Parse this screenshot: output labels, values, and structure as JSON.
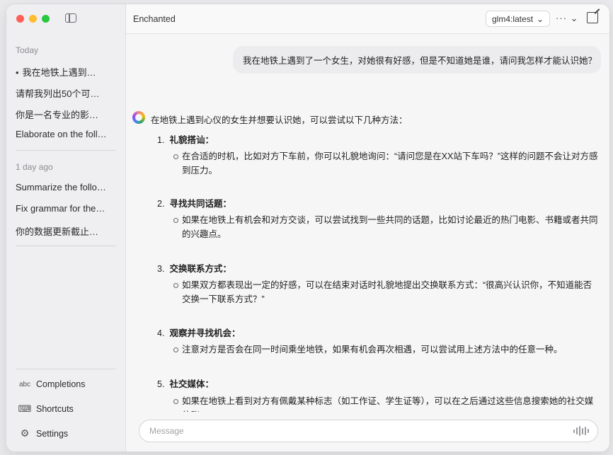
{
  "window": {
    "traffic_colors": [
      "#fe5f57",
      "#febc2e",
      "#28c840"
    ]
  },
  "sidebar": {
    "sections": [
      {
        "label": "Today",
        "items": [
          {
            "label": "我在地铁上遇到…",
            "active": true
          },
          {
            "label": "请帮我列出50个可…",
            "active": false
          },
          {
            "label": "你是一名专业的影…",
            "active": false
          },
          {
            "label": "Elaborate on the foll…",
            "active": false
          }
        ]
      },
      {
        "label": "1 day ago",
        "items": [
          {
            "label": "Summarize the follo…",
            "active": false
          },
          {
            "label": "Fix grammar for the…",
            "active": false
          },
          {
            "label": "你的数据更新截止…",
            "active": false
          }
        ]
      }
    ],
    "bottom": [
      {
        "icon": "abc-icon",
        "icon_text": "abc",
        "label": "Completions"
      },
      {
        "icon": "keyboard-icon",
        "icon_text": "⌨",
        "label": "Shortcuts"
      },
      {
        "icon": "gear-icon",
        "icon_text": "⚙",
        "label": "Settings"
      }
    ]
  },
  "topbar": {
    "title": "Enchanted",
    "model": "glm4:latest",
    "model_caret": "⌄",
    "more": "··· ⌄"
  },
  "conversation": {
    "user_message": "我在地铁上遇到了一个女生，对她很有好感，但是不知道她是谁，请问我怎样才能认识她？",
    "assistant_intro": "在地铁上遇到心仪的女生并想要认识她，可以尝试以下几种方法：",
    "items": [
      {
        "num": "1.",
        "title": "礼貌搭讪：",
        "body": "在合适的时机，比如对方下车前，你可以礼貌地询问：“请问您是在XX站下车吗？”这样的问题不会让对方感到压力。"
      },
      {
        "num": "2.",
        "title": "寻找共同话题：",
        "body": "如果在地铁上有机会和对方交谈，可以尝试找到一些共同的话题，比如讨论最近的热门电影、书籍或者共同的兴趣点。"
      },
      {
        "num": "3.",
        "title": "交换联系方式：",
        "body": "如果双方都表现出一定的好感，可以在结束对话时礼貌地提出交换联系方式：“很高兴认识你，不知道能否交换一下联系方式？”"
      },
      {
        "num": "4.",
        "title": "观察并寻找机会：",
        "body": "注意对方是否会在同一时间乘坐地铁，如果有机会再次相遇，可以尝试用上述方法中的任意一种。"
      },
      {
        "num": "5.",
        "title": "社交媒体：",
        "body": "如果在地铁上看到对方有佩戴某种标志（如工作证、学生证等），可以在之后通过这些信息搜索她的社交媒体账"
      }
    ]
  },
  "input": {
    "placeholder": "Message",
    "value": ""
  }
}
